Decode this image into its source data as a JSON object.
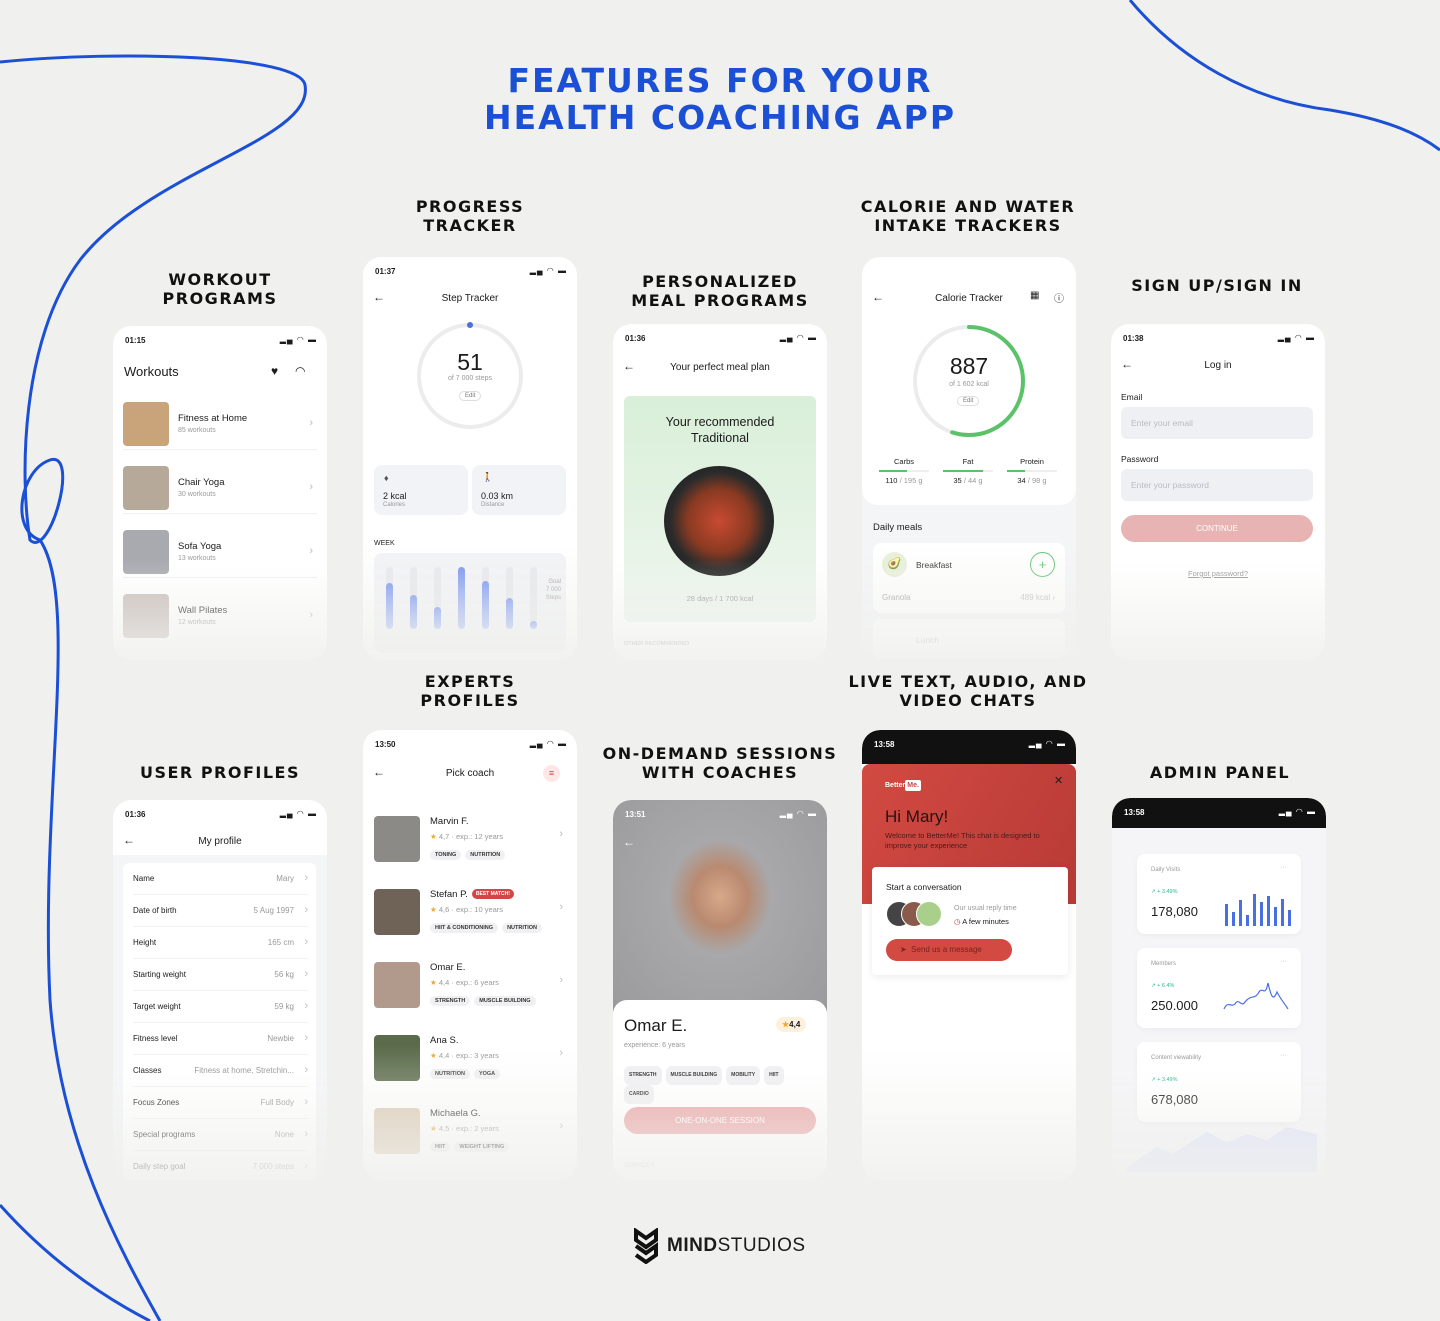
{
  "title": {
    "line1": "FEATURES FOR YOUR",
    "line2": "HEALTH COACHING APP"
  },
  "colors": {
    "accent": "#1a4fd6",
    "coral": "#c84545",
    "green": "#5bc26a",
    "chart_blue": "#4a6fe0"
  },
  "sections": {
    "workout": {
      "l1": "WORKOUT",
      "l2": "PROGRAMS"
    },
    "progress": {
      "l1": "PROGRESS",
      "l2": "TRACKER"
    },
    "meal": {
      "l1": "PERSONALIZED",
      "l2": "MEAL PROGRAMS"
    },
    "calorie": {
      "l1": "CALORIE AND WATER",
      "l2": "INTAKE TRACKERS"
    },
    "signin": {
      "l1": "SIGN UP/SIGN IN"
    },
    "user": {
      "l1": "USER PROFILES"
    },
    "experts": {
      "l1": "EXPERTS",
      "l2": "PROFILES"
    },
    "ondemand": {
      "l1": "ON-DEMAND SESSIONS",
      "l2": "WITH COACHES"
    },
    "chats": {
      "l1": "LIVE TEXT, AUDIO, AND",
      "l2": "VIDEO CHATS"
    },
    "admin": {
      "l1": "ADMIN PANEL"
    }
  },
  "workouts": {
    "time": "01:15",
    "title": "Workouts",
    "icons": [
      "heart-icon",
      "rainbow-icon"
    ],
    "items": [
      {
        "name": "Fitness at Home",
        "count": "85 workouts"
      },
      {
        "name": "Chair Yoga",
        "count": "30 workouts"
      },
      {
        "name": "Sofa Yoga",
        "count": "13 workouts"
      },
      {
        "name": "Wall Pilates",
        "count": "12 workouts"
      }
    ]
  },
  "steps": {
    "time": "01:37",
    "title": "Step Tracker",
    "value": "51",
    "goal": "of 7 000 steps",
    "edit": "Edit",
    "progress": 0.007,
    "stats": [
      {
        "value": "2 kcal",
        "label": "Calories",
        "icon": "flame-icon"
      },
      {
        "value": "0.03 km",
        "label": "Distance",
        "icon": "walking-icon"
      }
    ],
    "week_label": "WEEK",
    "goal_label": "Goal",
    "goal_value": "7 000",
    "goal_unit": "Steps",
    "week_levels": [
      0.75,
      0.55,
      0.35,
      1.0,
      0.78,
      0.5,
      0.12
    ]
  },
  "meal": {
    "time": "01:36",
    "title": "Your perfect meal plan",
    "rec_l1": "Your recommended",
    "rec_l2": "Traditional",
    "info": "28 days / 1 700 kcal",
    "other": "OTHER RECOMMENDED"
  },
  "calorie": {
    "title": "Calorie Tracker",
    "value": "887",
    "goal": "of 1 602 kcal",
    "edit": "Edit",
    "progress": 0.55,
    "macros": [
      {
        "name": "Carbs",
        "cur": "110",
        "tot": "/ 195 g",
        "pct": 0.56
      },
      {
        "name": "Fat",
        "cur": "35",
        "tot": "/ 44 g",
        "pct": 0.8
      },
      {
        "name": "Protein",
        "cur": "34",
        "tot": "/ 98 g",
        "pct": 0.35
      }
    ],
    "daily": "Daily meals",
    "meals": [
      {
        "name": "Breakfast",
        "item": "Granola",
        "kcal": "489 kcal"
      },
      {
        "name": "Lunch"
      }
    ]
  },
  "login": {
    "time": "01:38",
    "title": "Log in",
    "email_label": "Email",
    "email_ph": "Enter your email",
    "pass_label": "Password",
    "pass_ph": "Enter your password",
    "continue": "CONTINUE",
    "forgot": "Forgot password?"
  },
  "profile": {
    "time": "01:36",
    "title": "My profile",
    "rows": [
      {
        "k": "Name",
        "v": "Mary"
      },
      {
        "k": "Date of birth",
        "v": "5 Aug 1997"
      },
      {
        "k": "Height",
        "v": "165 cm"
      },
      {
        "k": "Starting weight",
        "v": "56 kg"
      },
      {
        "k": "Target weight",
        "v": "59 kg"
      },
      {
        "k": "Fitness level",
        "v": "Newbie"
      },
      {
        "k": "Classes",
        "v": "Fitness at home, Stretchin..."
      },
      {
        "k": "Focus Zones",
        "v": "Full Body"
      },
      {
        "k": "Special programs",
        "v": "None"
      },
      {
        "k": "Daily step goal",
        "v": "7 000 steps"
      }
    ]
  },
  "coaches": {
    "time": "13:50",
    "title": "Pick coach",
    "best": "BEST MATCH!",
    "items": [
      {
        "name": "Marvin F.",
        "rating": "4,7",
        "exp": "exp.: 12 years",
        "tags": [
          "TONING",
          "NUTRITION"
        ]
      },
      {
        "name": "Stefan P.",
        "rating": "4,6",
        "exp": "exp.: 10 years",
        "tags": [
          "HIIT & CONDITIONING",
          "NUTRITION"
        ]
      },
      {
        "name": "Omar E.",
        "rating": "4,4",
        "exp": "exp.: 6 years",
        "tags": [
          "STRENGTH",
          "MUSCLE BUILDING"
        ]
      },
      {
        "name": "Ana S.",
        "rating": "4,4",
        "exp": "exp.: 3 years",
        "tags": [
          "NUTRITION",
          "YOGA"
        ]
      },
      {
        "name": "Michaela G.",
        "rating": "4,5",
        "exp": "exp.: 2 years",
        "tags": [
          "HIIT",
          "WEIGHT LIFTING"
        ]
      }
    ]
  },
  "session": {
    "time": "13:51",
    "name": "Omar E.",
    "rating": "4,4",
    "exp": "experience: 6 years",
    "tags": [
      "STRENGTH",
      "MUSCLE BUILDING",
      "MOBILITY",
      "HIIT",
      "CARDIO"
    ],
    "button": "ONE-ON-ONE SESSION",
    "services": "SERVICES"
  },
  "chat": {
    "time": "13:58",
    "brand1": "Better",
    "brand2": "Me.",
    "greet": "Hi Mary!",
    "welcome": "Welcome to BetterMe! This chat is designed to improve your experience",
    "start": "Start a conversation",
    "reply": "Our usual reply time",
    "minutes": "A few minutes",
    "send": "Send us a message"
  },
  "admin": {
    "time": "13:58",
    "cards": [
      {
        "label": "Daily Visits",
        "delta": "+ 3.49%",
        "value": "178,080"
      },
      {
        "label": "Members",
        "delta": "+ 6.4%",
        "value": "250.000"
      },
      {
        "label": "Content viewability",
        "delta": "+ 3.49%",
        "value": "678,080"
      }
    ]
  },
  "brand": {
    "bold": "MIND",
    "light": "STUDIOS"
  }
}
